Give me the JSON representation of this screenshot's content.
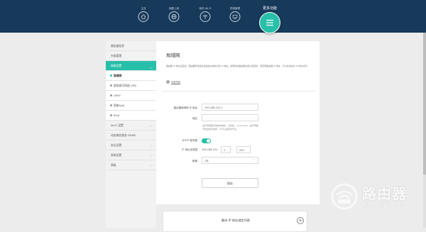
{
  "topnav": {
    "items": [
      {
        "label": "主页",
        "icon": "home-icon"
      },
      {
        "label": "我要上网",
        "icon": "globe-icon"
      },
      {
        "label": "我的 Wi-Fi",
        "icon": "wifi-icon"
      },
      {
        "label": "终端管理",
        "icon": "devices-icon"
      },
      {
        "label": "更多功能",
        "icon": "menu-icon"
      }
    ]
  },
  "sidebar": {
    "items": [
      {
        "label": "路由器信息",
        "type": "top"
      },
      {
        "label": "升级管理",
        "type": "top"
      },
      {
        "label": "网络设置",
        "type": "section-open"
      },
      {
        "label": "局域网",
        "type": "sub"
      },
      {
        "label": "虚拟拨号网络 VPN",
        "type": "sub"
      },
      {
        "label": "UPnP",
        "type": "sub"
      },
      {
        "label": "智能QoS",
        "type": "sub"
      },
      {
        "label": "IPv6",
        "type": "sub"
      },
      {
        "label": "Wi-Fi 设置",
        "type": "section"
      },
      {
        "label": "动态域名服务 DDNS",
        "type": "top"
      },
      {
        "label": "安全设置",
        "type": "section"
      },
      {
        "label": "系统设置",
        "type": "section"
      },
      {
        "label": "高级",
        "type": "section"
      }
    ]
  },
  "main": {
    "title": "局域网",
    "description": "路由器 IP 地址设置后，路由器所连接的设备会在重新分配 IP 地址。如果您的路由器在默认配置时，若获取路由器 IP 地址，可以在地址栏 IP 地址访问。",
    "help_link": "查看帮助",
    "form": {
      "router_ip_label": "路由器局域网 IP 地址",
      "router_ip_value": "192.168.101.1",
      "domain_label": "域名",
      "domain_value": "",
      "domain_hint": "由字母和数字组成的域名，访问如：mydomain，由字母数字和连接符组成，不可以连接符开头。",
      "dhcp_label": "DHCP 服务器",
      "dhcp_enabled": true,
      "ip_range_label": "IP 地址池范围",
      "ip_range_prefix": "192.168.101.",
      "ip_range_start": "2",
      "ip_range_dash": "-",
      "ip_range_end": "254",
      "lease_label": "租期",
      "lease_value": "1天",
      "save_label": "保存"
    },
    "static_ip": {
      "title": "静态 IP 地址绑定列表"
    }
  },
  "watermark": {
    "text": "路由器",
    "sub": "luyouqi.com"
  },
  "colors": {
    "topbar": "#17395a",
    "accent": "#27bfa9",
    "background": "#ececec"
  }
}
